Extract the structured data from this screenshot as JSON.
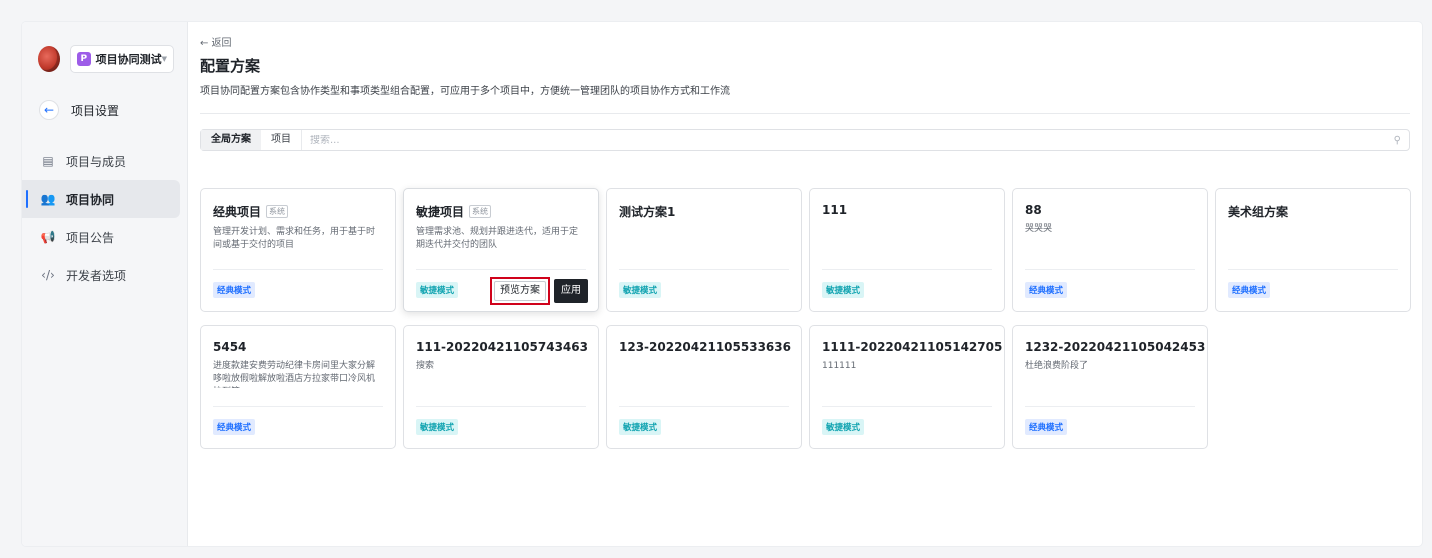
{
  "sidebar": {
    "project_name": "项目协同测试",
    "project_badge": "P",
    "back_label": "项目设置",
    "items": [
      {
        "label": "项目与成员",
        "icon": "member-card-icon"
      },
      {
        "label": "项目协同",
        "icon": "people-icon",
        "active": true
      },
      {
        "label": "项目公告",
        "icon": "megaphone-icon"
      },
      {
        "label": "开发者选项",
        "icon": "code-icon"
      }
    ]
  },
  "header": {
    "back": "← 返回",
    "title": "配置方案",
    "description": "项目协同配置方案包含协作类型和事项类型组合配置，可应用于多个项目中，方便统一管理团队的项目协作方式和工作流"
  },
  "filter": {
    "tabs": [
      {
        "label": "全局方案",
        "active": true
      },
      {
        "label": "项目"
      }
    ],
    "search_placeholder": "搜索..."
  },
  "cards": [
    {
      "title": "经典项目",
      "system": "系统",
      "desc": "管理开发计划、需求和任务，用于基于时间或基于交付的项目",
      "mode": "经典模式",
      "mode_type": "classic"
    },
    {
      "title": "敏捷项目",
      "system": "系统",
      "desc": "管理需求池、规划并跟进迭代，适用于定期迭代并交付的团队",
      "mode": "敏捷模式",
      "mode_type": "agile",
      "actions": {
        "preview": "预览方案",
        "apply": "应用"
      }
    },
    {
      "title": "测试方案1",
      "desc": "",
      "mode": "敏捷模式",
      "mode_type": "agile"
    },
    {
      "title": "111",
      "desc": "",
      "mode": "敏捷模式",
      "mode_type": "agile"
    },
    {
      "title": "88",
      "desc": "哭哭哭",
      "mode": "经典模式",
      "mode_type": "classic"
    },
    {
      "title": "美术组方案",
      "desc": "",
      "mode": "经典模式",
      "mode_type": "classic"
    },
    {
      "title": "5454",
      "desc": "进度款建安费劳动纪律卡房间里大家分解哆啦放假啦解放啦酒店方拉家带口冷风机拉到筐...",
      "mode": "经典模式",
      "mode_type": "classic"
    },
    {
      "title": "111-20220421105743463",
      "desc": "搜索",
      "mode": "敏捷模式",
      "mode_type": "agile"
    },
    {
      "title": "123-20220421105533636",
      "desc": "",
      "mode": "敏捷模式",
      "mode_type": "agile"
    },
    {
      "title": "1111-20220421105142705",
      "desc": "111111",
      "mode": "敏捷模式",
      "mode_type": "agile"
    },
    {
      "title": "1232-20220421105042453",
      "desc": "杜绝浪费阶段了",
      "mode": "经典模式",
      "mode_type": "classic"
    }
  ],
  "colors": {
    "accent": "#1e6fff",
    "highlight": "#d0021b",
    "classic_tag_bg": "#e1eaff",
    "agile_tag_bg": "#d9f5f6"
  }
}
